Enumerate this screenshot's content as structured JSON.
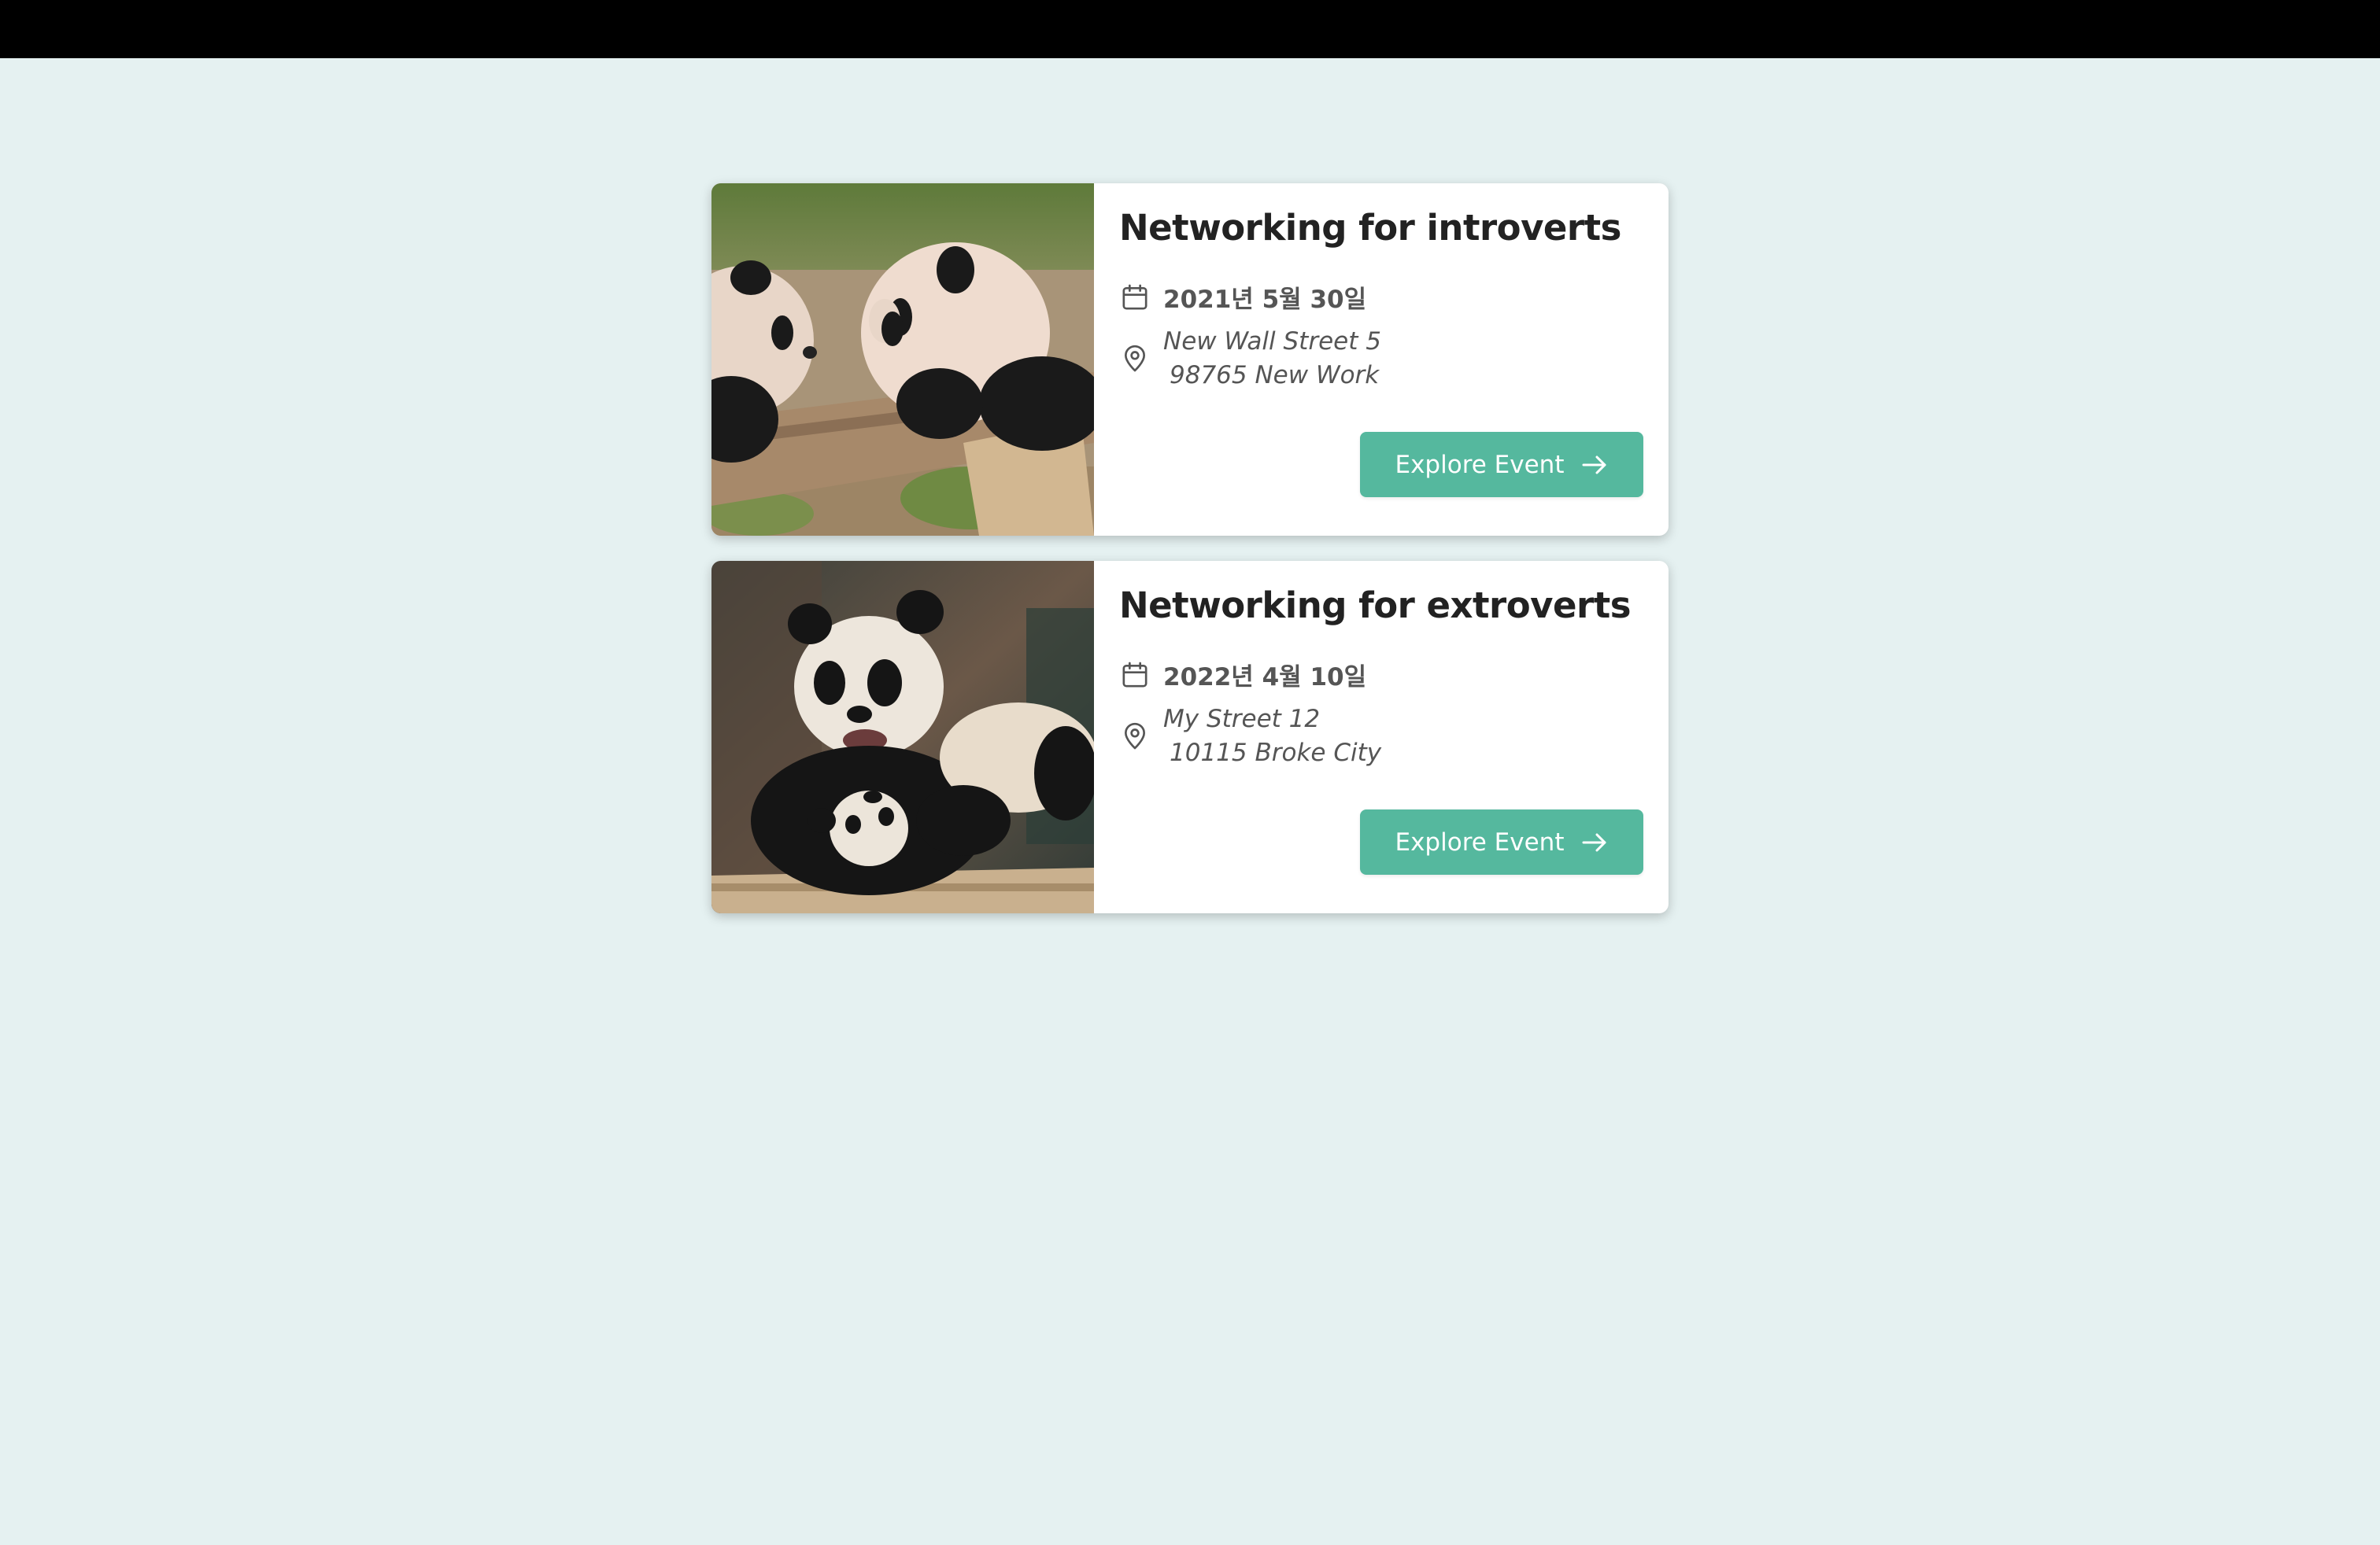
{
  "events": [
    {
      "title": "Networking for introverts",
      "date": "2021년 5월 30일",
      "address_line1": "New Wall Street 5",
      "address_line2": "98765 New Work",
      "button_label": "Explore Event",
      "image": "two-pandas-on-log"
    },
    {
      "title": "Networking for extroverts",
      "date": "2022년 4월 10일",
      "address_line1": "My Street 12",
      "address_line2": "10115 Broke City",
      "button_label": "Explore Event",
      "image": "panda-mother-and-cub"
    }
  ],
  "colors": {
    "page_background": "#e5f1f1",
    "topbar": "#000000",
    "card_background": "#ffffff",
    "button": "#55b89e",
    "title_text": "#222222",
    "meta_text": "#555555"
  },
  "icons": {
    "date": "calendar-icon",
    "location": "map-pin-icon",
    "button": "arrow-right-icon"
  }
}
